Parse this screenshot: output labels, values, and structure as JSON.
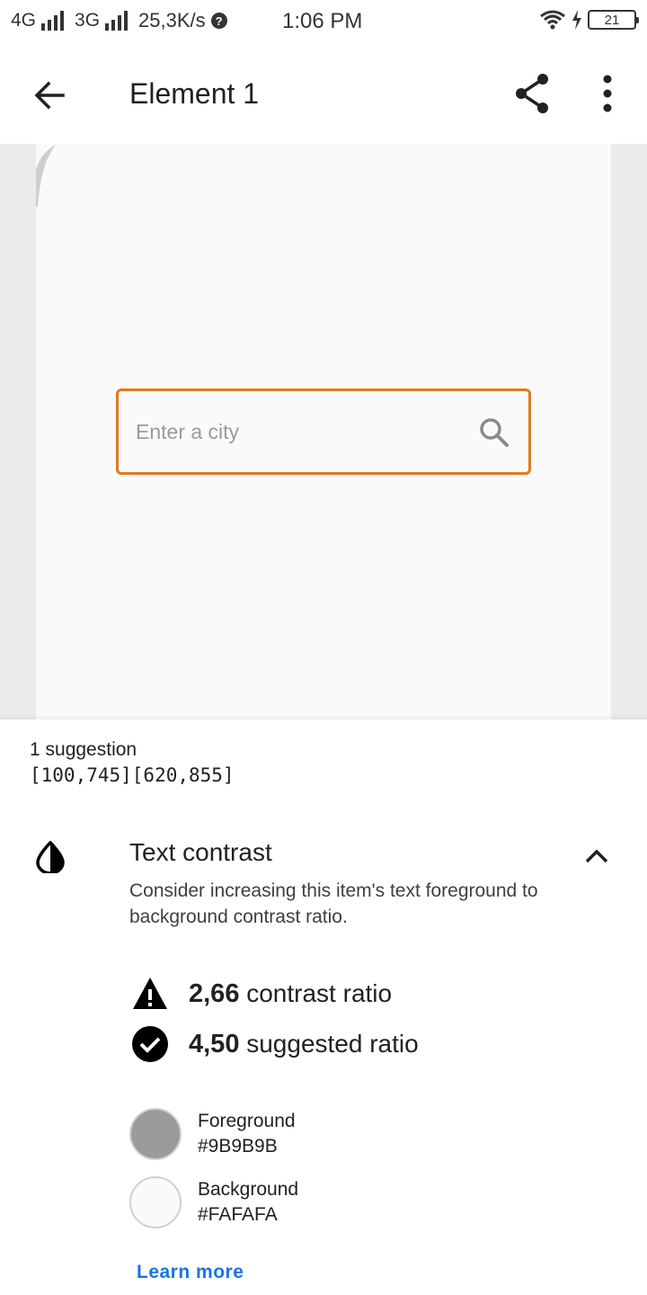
{
  "status_bar": {
    "net1": "4G",
    "net2": "3G",
    "speed": "25,3K/s",
    "time": "1:06 PM",
    "battery": "21"
  },
  "app_bar": {
    "title": "Element 1"
  },
  "preview": {
    "search_placeholder": "Enter a city",
    "highlight_color": "#e07b1c"
  },
  "sheet": {
    "suggestion_count": "1 suggestion",
    "coords": "[100,745][620,855]",
    "section_title": "Text contrast",
    "section_desc": "Consider increasing this item's text foreground to background contrast ratio.",
    "current_ratio_value": "2,66",
    "current_ratio_label": "contrast ratio",
    "suggested_ratio_value": "4,50",
    "suggested_ratio_label": "suggested ratio",
    "foreground_label": "Foreground",
    "foreground_hex": "#9B9B9B",
    "background_label": "Background",
    "background_hex": "#FAFAFA",
    "learn_more": "Learn more"
  }
}
